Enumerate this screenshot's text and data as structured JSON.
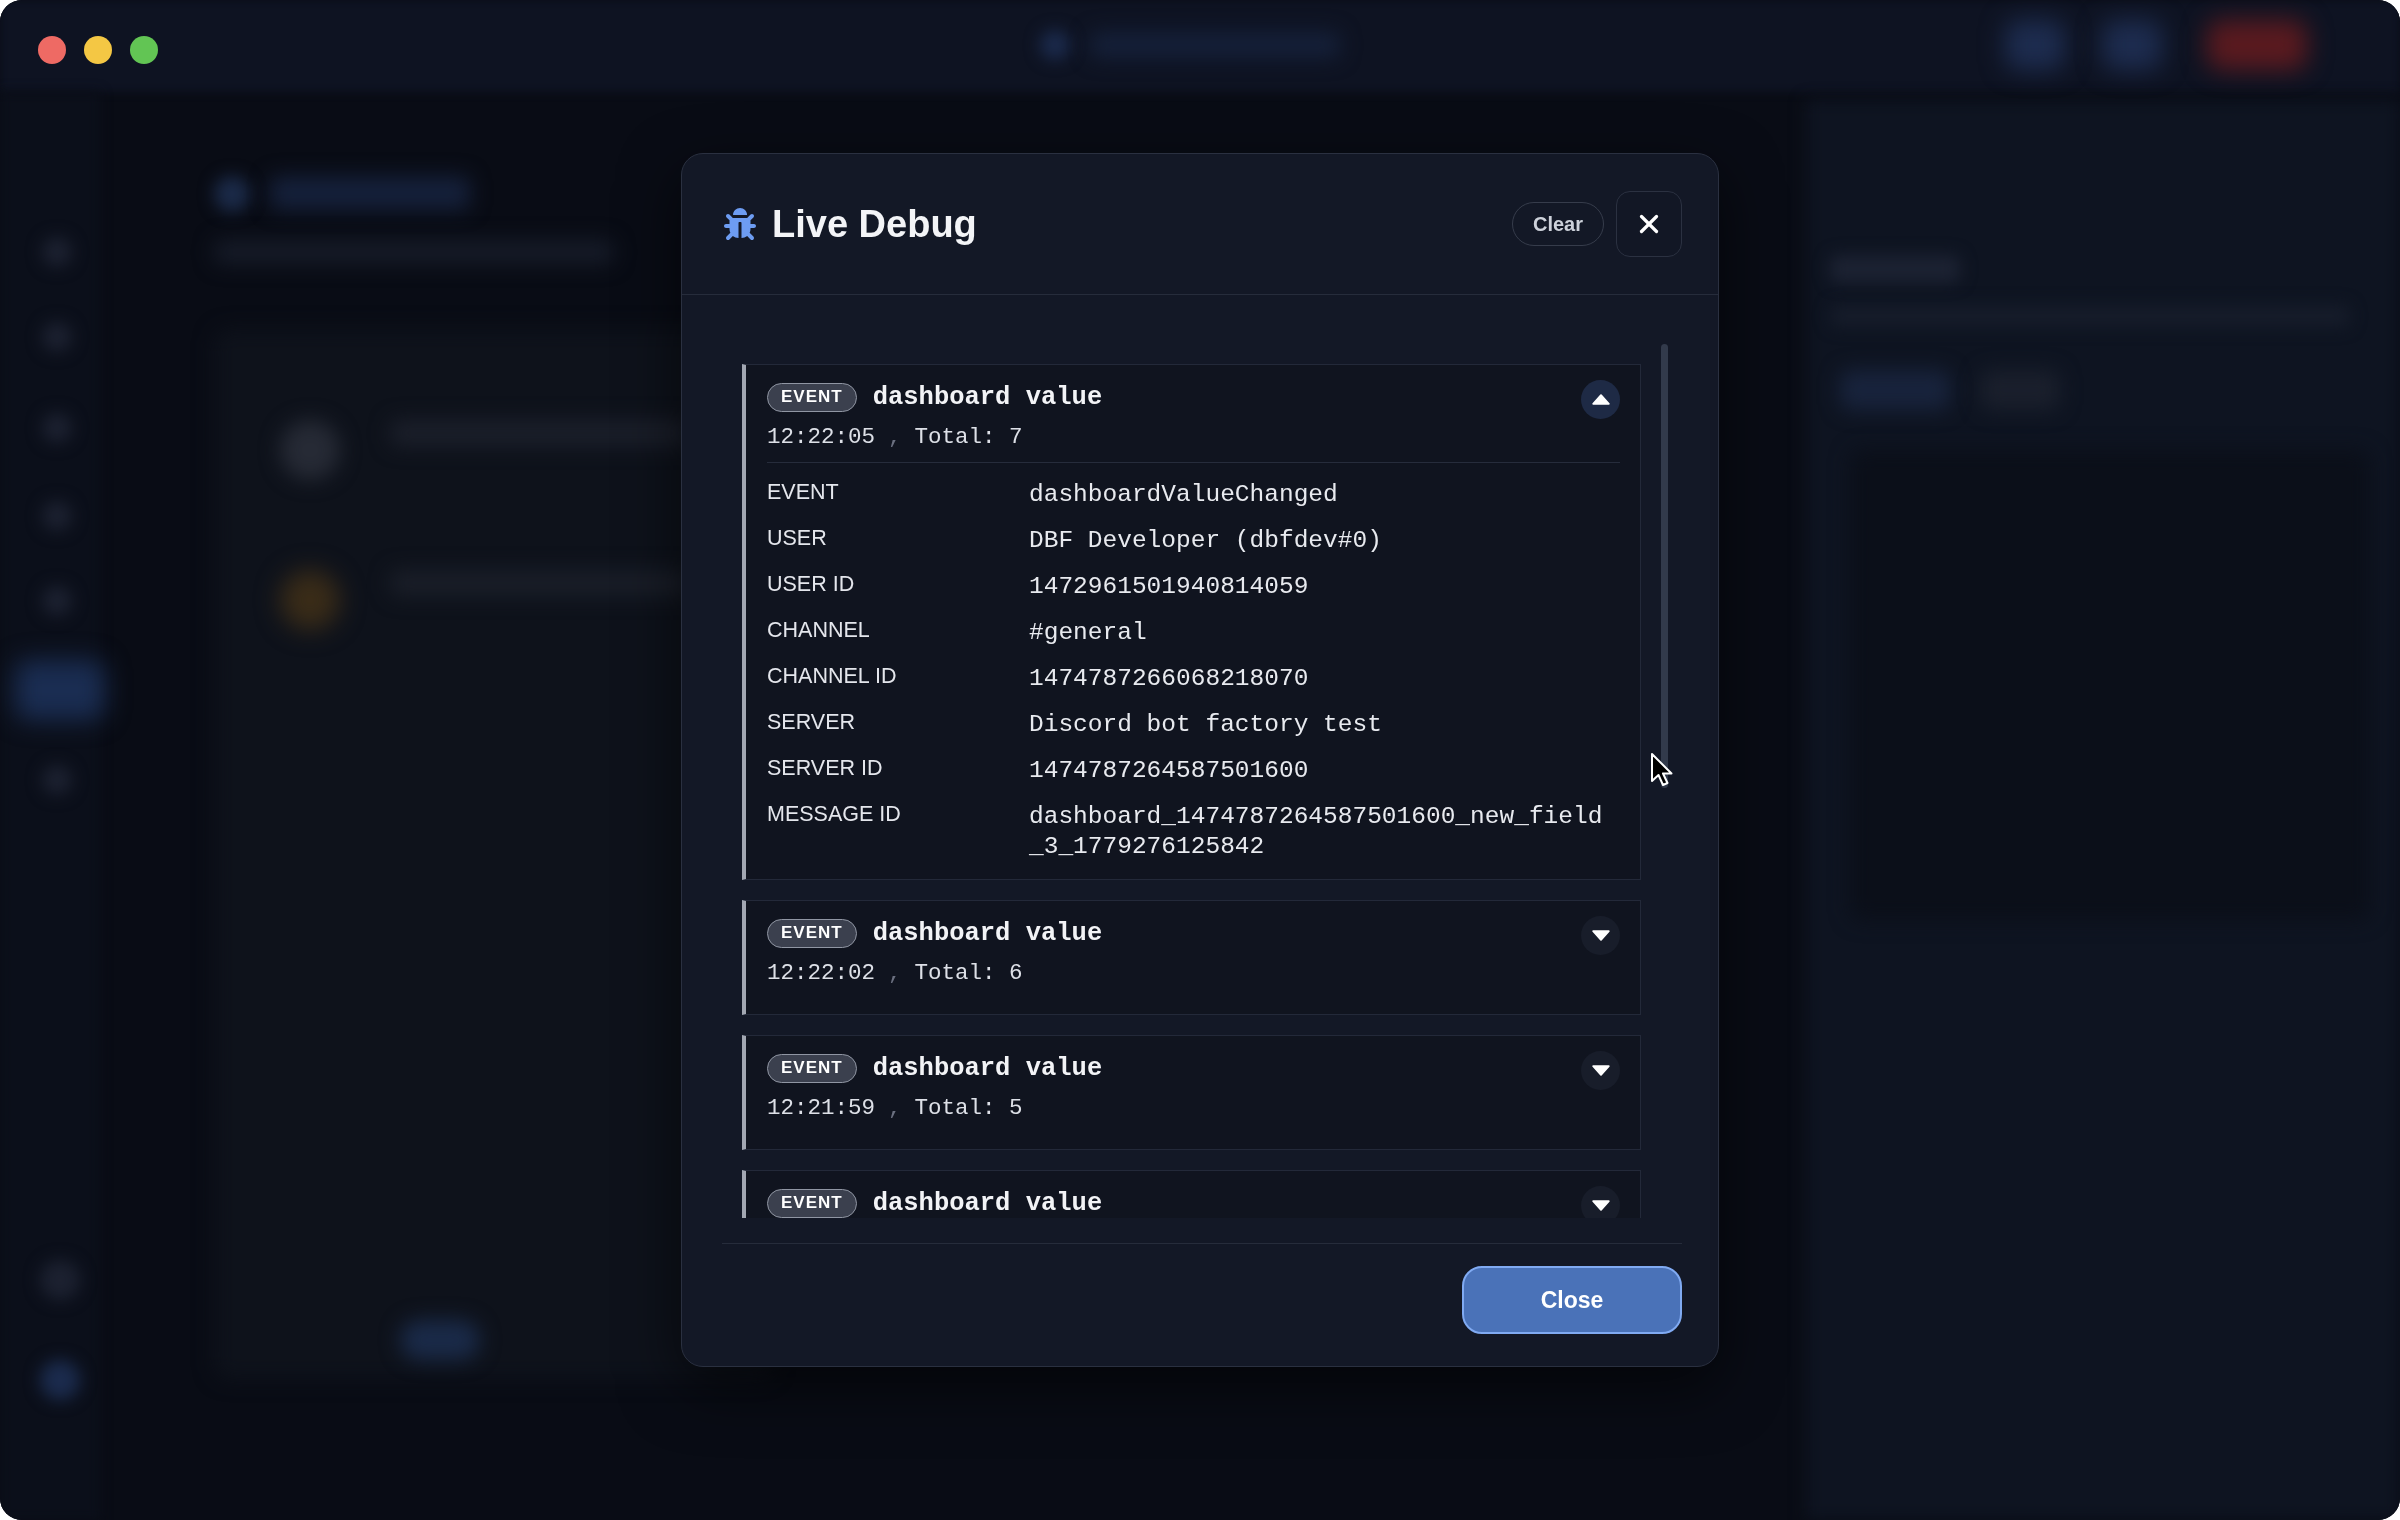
{
  "dialog": {
    "title": "Live Debug",
    "clear_button": "Clear",
    "entries": [
      {
        "badge": "EVENT",
        "name": "dashboard value",
        "time": "12:22:05",
        "separator": ",",
        "total": "Total: 7",
        "expanded": true,
        "details": [
          {
            "label": "EVENT",
            "value": "dashboardValueChanged"
          },
          {
            "label": "USER",
            "value": "DBF Developer (dbfdev#0)"
          },
          {
            "label": "USER ID",
            "value": "1472961501940814059"
          },
          {
            "label": "CHANNEL",
            "value": "#general"
          },
          {
            "label": "CHANNEL ID",
            "value": "1474787266068218070"
          },
          {
            "label": "SERVER",
            "value": "Discord bot factory test"
          },
          {
            "label": "SERVER ID",
            "value": "1474787264587501600"
          },
          {
            "label": "MESSAGE ID",
            "value": "dashboard_1474787264587501600_new_field_3_1779276125842"
          }
        ]
      },
      {
        "badge": "EVENT",
        "name": "dashboard value",
        "time": "12:22:02",
        "separator": ",",
        "total": "Total: 6",
        "expanded": false
      },
      {
        "badge": "EVENT",
        "name": "dashboard value",
        "time": "12:21:59",
        "separator": ",",
        "total": "Total: 5",
        "expanded": false
      },
      {
        "badge": "EVENT",
        "name": "dashboard value",
        "expanded": false
      }
    ],
    "close_button": "Close"
  }
}
